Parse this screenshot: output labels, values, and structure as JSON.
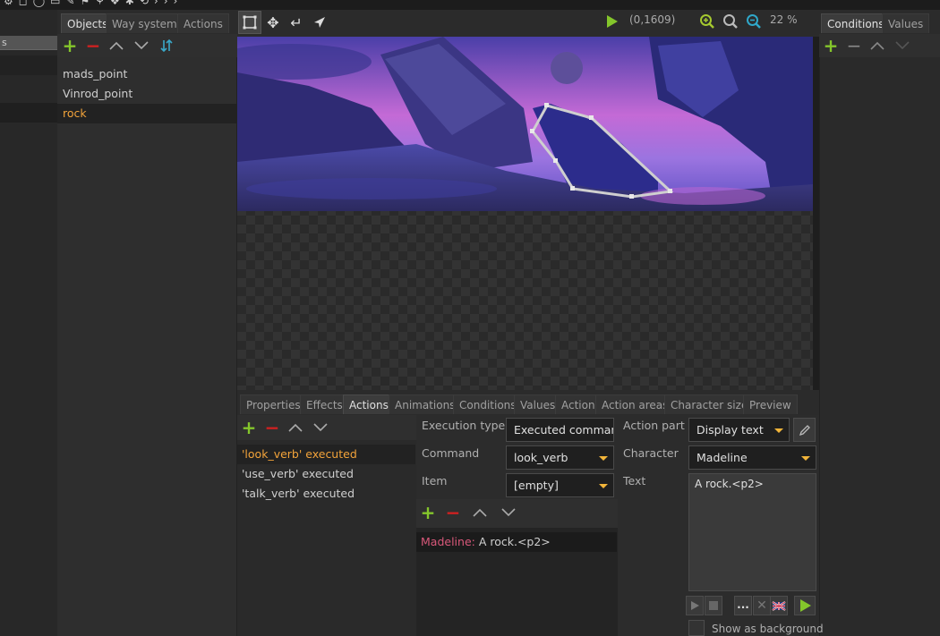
{
  "top_toolbar": {
    "coords": "(0,1609)",
    "zoom": "22 %"
  },
  "left_panel": {
    "label_fragment": "s"
  },
  "objects_panel": {
    "tabs": [
      "Objects",
      "Way systems",
      "Actions"
    ],
    "items": [
      {
        "label": "mads_point",
        "selected": false
      },
      {
        "label": "Vinrod_point",
        "selected": false
      },
      {
        "label": "rock",
        "selected": true
      }
    ]
  },
  "right_panel": {
    "tabs": [
      "Conditions",
      "Values"
    ]
  },
  "bottom_tabs": [
    "Properties",
    "Effects",
    "Actions",
    "Animations",
    "Conditions",
    "Values",
    "Action",
    "Action areas",
    "Character size",
    "Preview"
  ],
  "actions_list": [
    {
      "label": "'look_verb' executed",
      "selected": true
    },
    {
      "label": "'use_verb' executed",
      "selected": false
    },
    {
      "label": "'talk_verb' executed",
      "selected": false
    }
  ],
  "action_form": {
    "execution_type_label": "Execution type",
    "execution_type_value": "Executed command",
    "command_label": "Command",
    "command_value": "look_verb",
    "item_label": "Item",
    "item_value": "[empty]"
  },
  "action_part_list": [
    {
      "speaker": "Madeline",
      "separator": ": ",
      "text": "A rock.<p2>"
    }
  ],
  "action_part_panel": {
    "action_part_label": "Action part",
    "action_part_value": "Display text",
    "character_label": "Character",
    "character_value": "Madeline",
    "text_label": "Text",
    "text_value": "A rock.<p2>",
    "more_label": "...",
    "show_as_background_label": "Show as background"
  },
  "colors": {
    "accent_orange": "#f2a33a",
    "add_green": "#84c62b",
    "remove_red": "#d02020",
    "speaker_pink": "#d9587a"
  }
}
